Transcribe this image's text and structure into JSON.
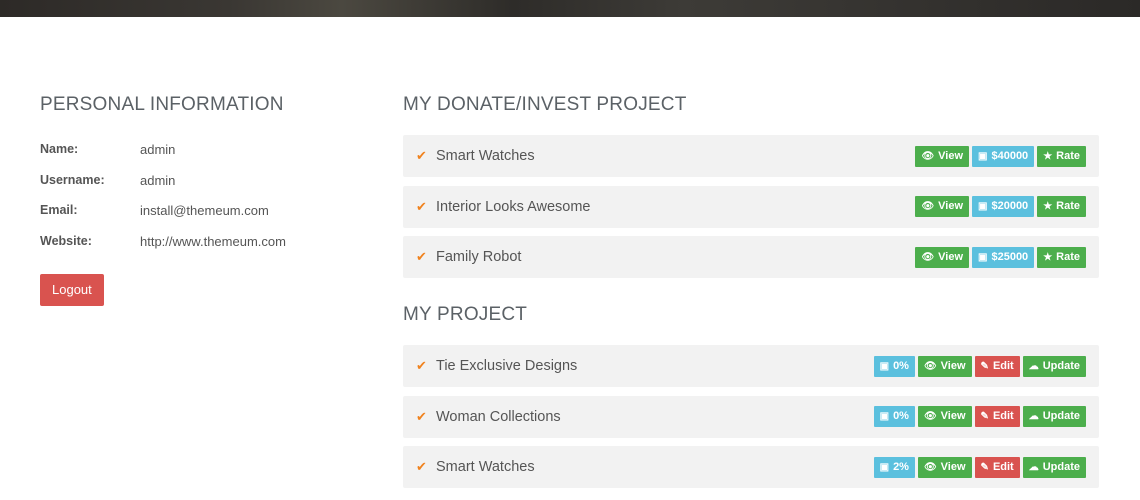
{
  "personal": {
    "title": "PERSONAL INFORMATION",
    "rows": [
      {
        "label": "Name:",
        "value": "admin"
      },
      {
        "label": "Username:",
        "value": "admin"
      },
      {
        "label": "Email:",
        "value": "install@themeum.com"
      },
      {
        "label": "Website:",
        "value": "http://www.themeum.com"
      }
    ],
    "logout_label": "Logout"
  },
  "donate": {
    "title": "MY DONATE/INVEST PROJECT",
    "items": [
      {
        "name": "Smart Watches",
        "view": "View",
        "amount": "$40000",
        "rate": "Rate"
      },
      {
        "name": "Interior Looks Awesome",
        "view": "View",
        "amount": "$20000",
        "rate": "Rate"
      },
      {
        "name": "Family Robot",
        "view": "View",
        "amount": "$25000",
        "rate": "Rate"
      }
    ]
  },
  "projects": {
    "title": "MY PROJECT",
    "items": [
      {
        "name": "Tie Exclusive Designs",
        "percent": "0%",
        "view": "View",
        "edit": "Edit",
        "update": "Update"
      },
      {
        "name": "Woman Collections",
        "percent": "0%",
        "view": "View",
        "edit": "Edit",
        "update": "Update"
      },
      {
        "name": "Smart Watches",
        "percent": "2%",
        "view": "View",
        "edit": "Edit",
        "update": "Update"
      }
    ]
  },
  "icons": {
    "check": "check-icon",
    "view": "eye-icon",
    "money": "money-icon",
    "rate": "star-icon",
    "edit": "pencil-icon",
    "update": "cloud-upload-icon"
  },
  "colors": {
    "green": "#4cae4c",
    "blue": "#5bc0de",
    "red": "#d9534f",
    "check": "#f0821e"
  }
}
